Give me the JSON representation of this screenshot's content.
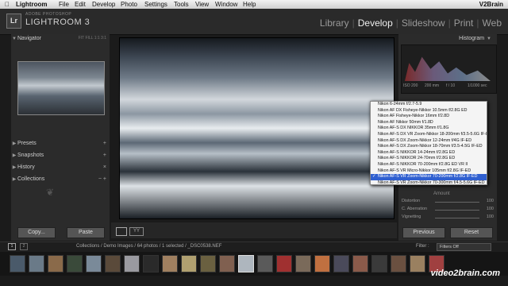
{
  "menubar": {
    "app": "Lightroom",
    "items": [
      "File",
      "Edit",
      "Develop",
      "Photo",
      "Settings",
      "Tools",
      "View",
      "Window",
      "Help"
    ],
    "right": "V2Brain"
  },
  "header": {
    "logo": "Lr",
    "brand_small": "ADOBE PHOTOSHOP",
    "brand_big": "LIGHTROOM 3",
    "modules": [
      "Library",
      "Develop",
      "Slideshow",
      "Print",
      "Web"
    ],
    "active_module": "Develop"
  },
  "left_panel": {
    "navigator": {
      "title": "Navigator",
      "options": "FIT  FILL  1:1  3:1"
    },
    "presets": "Presets",
    "snapshots": "Snapshots",
    "history": "History",
    "collections": "Collections",
    "copy": "Copy...",
    "paste": "Paste"
  },
  "right_panel": {
    "histogram": "Histogram",
    "exif": [
      "ISO 200",
      "200 mm",
      "f / 10",
      "1/1000 sec"
    ],
    "amount": "Amount",
    "sliders": [
      {
        "name": "Distortion",
        "value": "100"
      },
      {
        "name": "C. Aberration",
        "value": "100"
      },
      {
        "name": "Vignetting",
        "value": "100"
      }
    ],
    "previous": "Previous",
    "reset": "Reset"
  },
  "lens_dropdown": {
    "items": [
      "Nikon 6-24mm f/2.7-5.9",
      "Nikon AF DX Fisheye-Nikkor 10.5mm f/2.8G ED",
      "Nikon AF Fisheye-Nikkor 16mm f/2.8D",
      "Nikon AF Nikkor 50mm f/1.8D",
      "Nikon AF-S DX NIKKOR 35mm f/1.8G",
      "Nikon AF-S DX VR Zoom-Nikkor 18-200mm f/3.5-5.6G IF-ED",
      "Nikon AF-S DX Zoom-Nikkor 12-24mm f/4G IF-ED",
      "Nikon AF-S DX Zoom-Nikkor 18-70mm f/3.5-4.5G IF-ED",
      "Nikon AF-S NIKKOR 14-24mm f/2.8G ED",
      "Nikon AF-S NIKKOR 24-70mm f/2.8G ED",
      "Nikon AF-S NIKKOR 70-200mm f/2.8G ED VR II",
      "Nikon AF-S VR Micro-Nikkor 105mm f/2.8G IF-ED",
      "Nikon AF-S VR Zoom-Nikkor 70-200mm f/2.8G IF-ED",
      "Nikon AF-S VR Zoom-Nikkor 70-300mm f/4.5-5.6G IF-ED"
    ],
    "selected_index": 12
  },
  "filmstrip": {
    "page1": "1",
    "page2": "2",
    "path": "Collections / Demo Images / 64 photos / 1 selected / _DSC0538.NEF",
    "filter_label": "Filter :",
    "filter_value": "Filters Off"
  },
  "watermark": "video2brain.com",
  "colors": {
    "accent_selected": "#2f5fd0",
    "panel_bg": "#2b2b2b",
    "app_bg": "#1b1b1b"
  }
}
